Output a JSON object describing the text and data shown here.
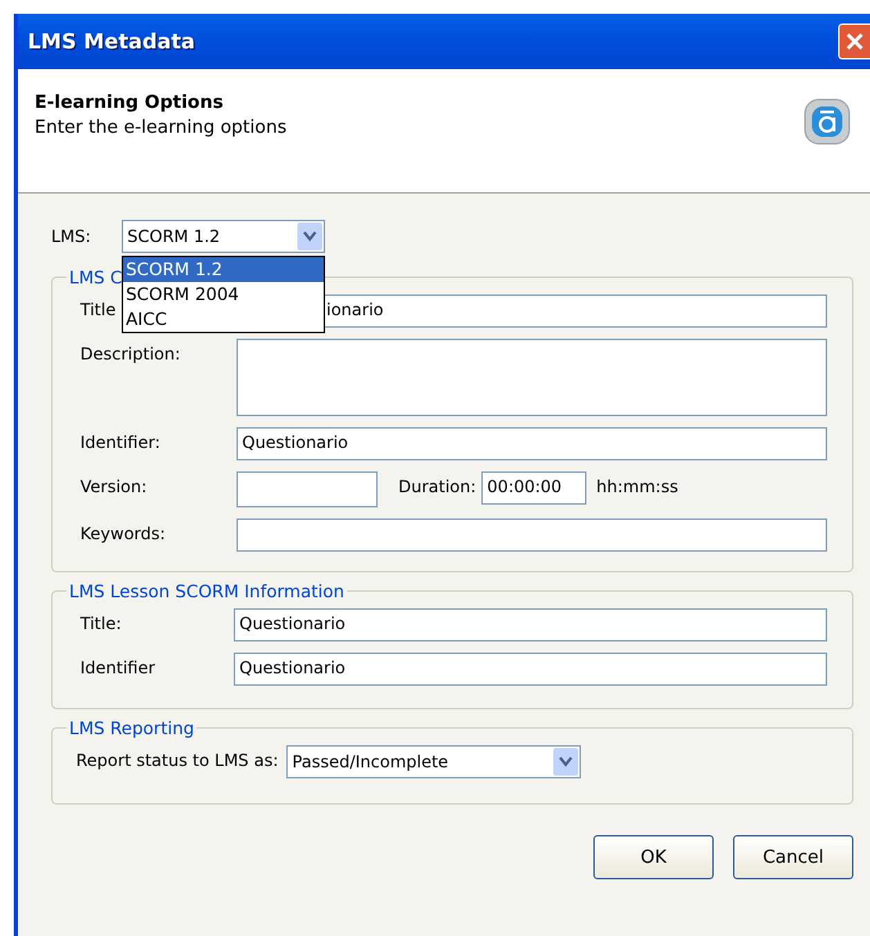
{
  "window": {
    "title": "LMS Metadata"
  },
  "header": {
    "title": "E-learning Options",
    "subtitle": "Enter the e-learning options"
  },
  "lms": {
    "label": "LMS:",
    "value": "SCORM 1.2",
    "expanded": true,
    "options": [
      {
        "label": "SCORM 1.2",
        "selected": true
      },
      {
        "label": "SCORM 2004",
        "selected": false
      },
      {
        "label": "AICC",
        "selected": false
      }
    ]
  },
  "course_group": {
    "legend": "LMS C",
    "fields": [
      {
        "kind": "text",
        "label": "Title",
        "value": "ionario"
      },
      {
        "kind": "multiline",
        "label": "Description:"
      },
      {
        "kind": "text",
        "label": "Identifier:",
        "value": "Questionario"
      },
      {
        "kind": "version",
        "label": "Version:",
        "duration_label": "Duration:",
        "duration": "00:00:00",
        "duration_hint": "hh:mm:ss"
      },
      {
        "kind": "text",
        "label": "Keywords:"
      }
    ]
  },
  "lesson_group": {
    "legend": "LMS Lesson SCORM Information",
    "fields": [
      {
        "label": "Title:",
        "value": "Questionario"
      },
      {
        "label": "Identifier",
        "value": "Questionario"
      }
    ]
  },
  "reporting_group": {
    "legend": "LMS Reporting",
    "label": "Report status to LMS as:",
    "value": "Passed/Incomplete"
  },
  "buttons": [
    "OK",
    "Cancel"
  ]
}
